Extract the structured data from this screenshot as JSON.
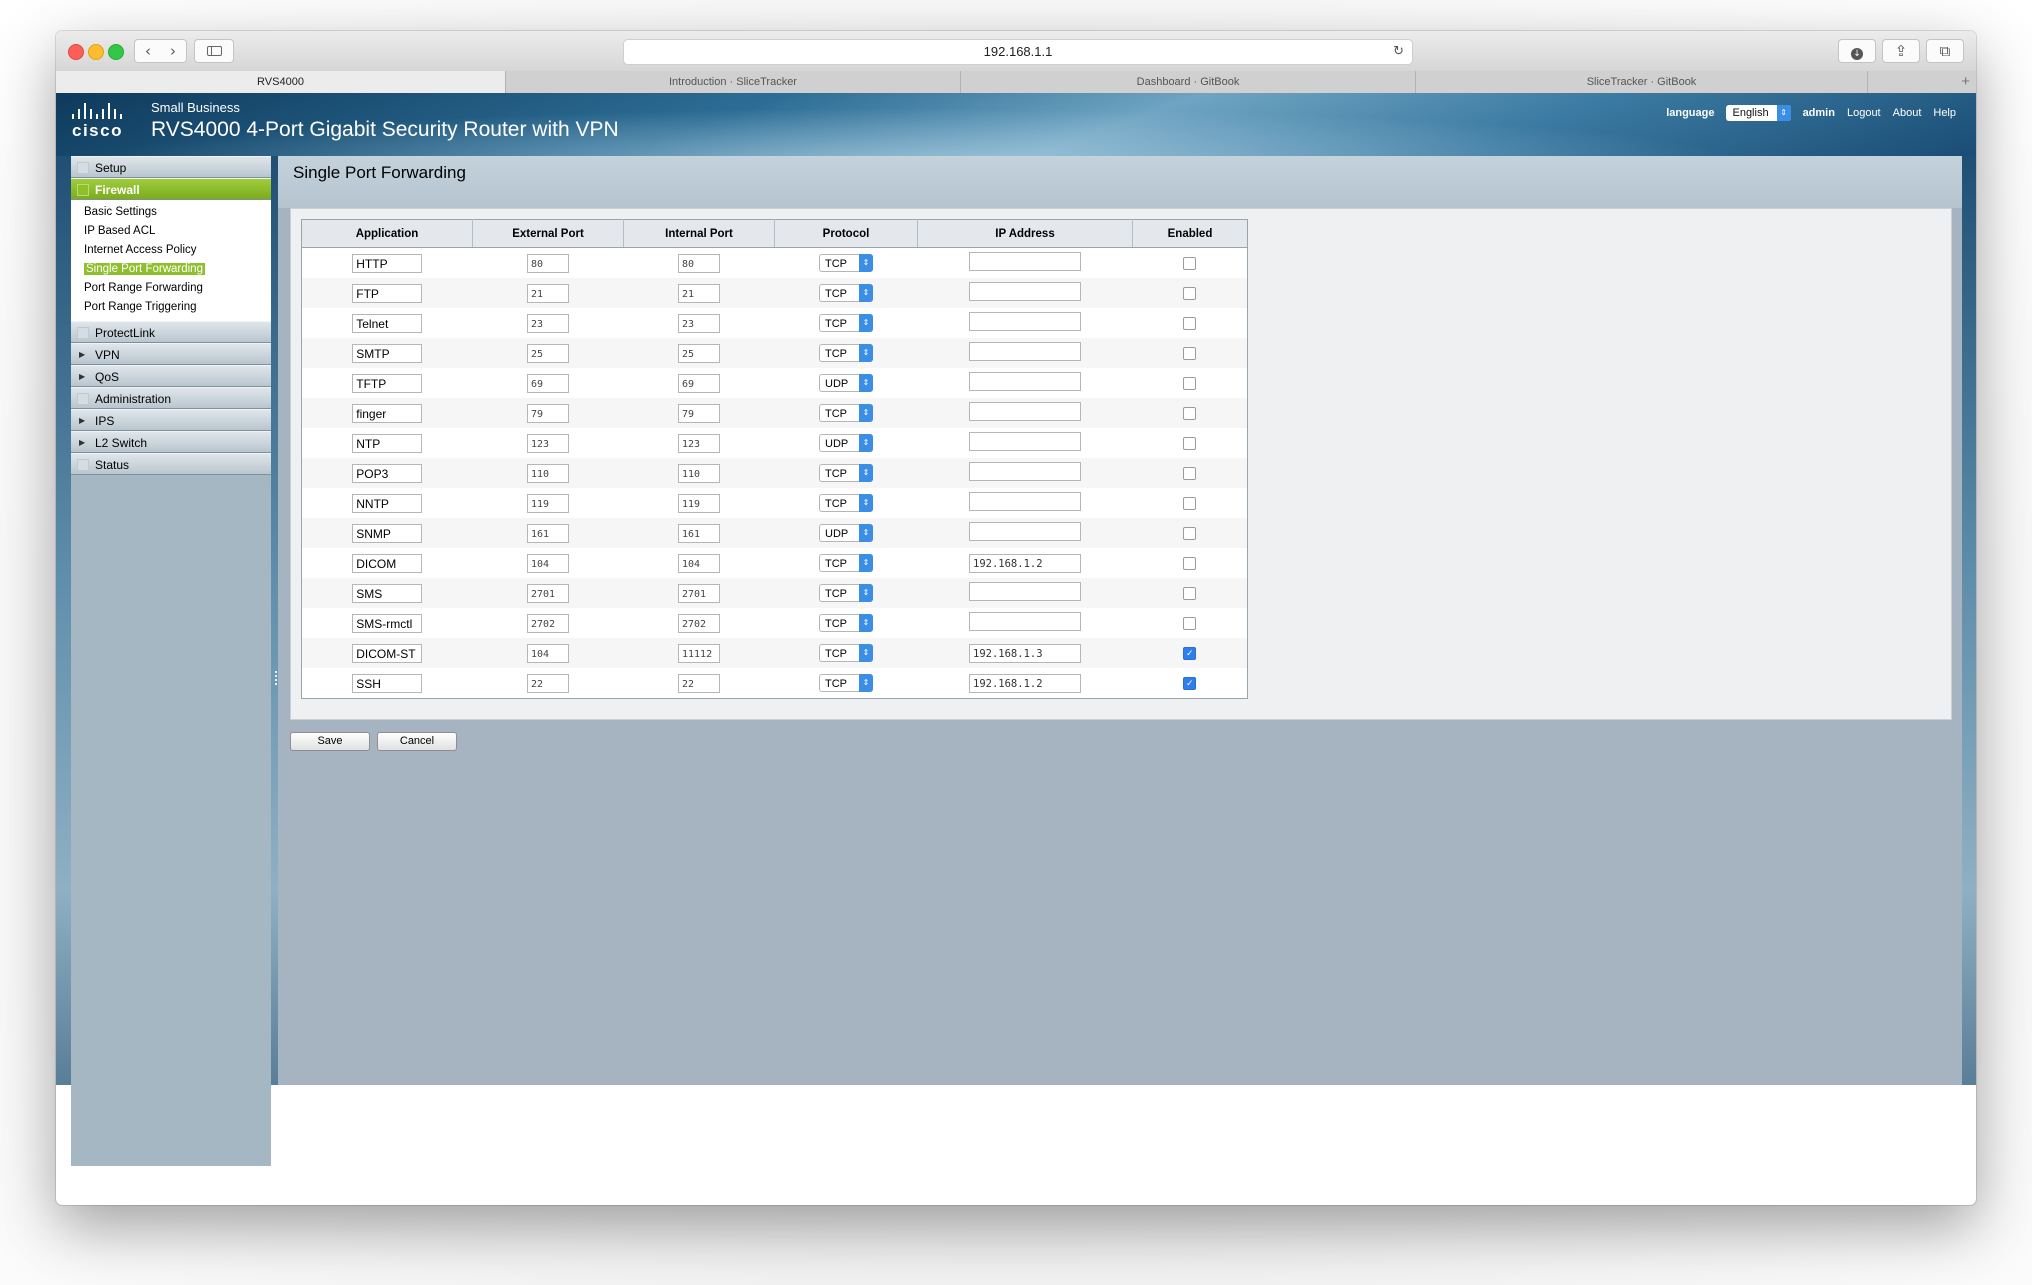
{
  "browser": {
    "address": "192.168.1.1",
    "tabs": [
      {
        "label": "RVS4000",
        "active": true
      },
      {
        "label": "Introduction · SliceTracker",
        "active": false
      },
      {
        "label": "Dashboard · GitBook",
        "active": false
      },
      {
        "label": "SliceTracker · GitBook",
        "active": false
      }
    ],
    "new_tab": "+"
  },
  "header": {
    "brand": "cisco",
    "small_business": "Small Business",
    "title": "RVS4000 4-Port Gigabit Security Router with VPN",
    "language_label": "language",
    "language_value": "English",
    "user": "admin",
    "logout": "Logout",
    "about": "About",
    "help": "Help"
  },
  "sidenav": {
    "items": [
      {
        "label": "Setup"
      },
      {
        "label": "Firewall",
        "active": true
      },
      {
        "label": "ProtectLink"
      },
      {
        "label": "VPN",
        "expandable": true
      },
      {
        "label": "QoS",
        "expandable": true
      },
      {
        "label": "Administration"
      },
      {
        "label": "IPS",
        "expandable": true
      },
      {
        "label": "L2 Switch",
        "expandable": true
      },
      {
        "label": "Status"
      }
    ],
    "firewall_sub": [
      {
        "label": "Basic Settings"
      },
      {
        "label": "IP Based ACL"
      },
      {
        "label": "Internet Access Policy"
      },
      {
        "label": "Single Port Forwarding",
        "active": true
      },
      {
        "label": "Port Range Forwarding"
      },
      {
        "label": "Port Range Triggering"
      }
    ]
  },
  "main": {
    "page_title": "Single Port Forwarding",
    "columns": [
      "Application",
      "External Port",
      "Internal Port",
      "Protocol",
      "IP Address",
      "Enabled"
    ],
    "rows": [
      {
        "app": "HTTP",
        "ext": "80",
        "int": "80",
        "proto": "TCP",
        "ip": "",
        "enabled": false
      },
      {
        "app": "FTP",
        "ext": "21",
        "int": "21",
        "proto": "TCP",
        "ip": "",
        "enabled": false
      },
      {
        "app": "Telnet",
        "ext": "23",
        "int": "23",
        "proto": "TCP",
        "ip": "",
        "enabled": false
      },
      {
        "app": "SMTP",
        "ext": "25",
        "int": "25",
        "proto": "TCP",
        "ip": "",
        "enabled": false
      },
      {
        "app": "TFTP",
        "ext": "69",
        "int": "69",
        "proto": "UDP",
        "ip": "",
        "enabled": false
      },
      {
        "app": "finger",
        "ext": "79",
        "int": "79",
        "proto": "TCP",
        "ip": "",
        "enabled": false
      },
      {
        "app": "NTP",
        "ext": "123",
        "int": "123",
        "proto": "UDP",
        "ip": "",
        "enabled": false
      },
      {
        "app": "POP3",
        "ext": "110",
        "int": "110",
        "proto": "TCP",
        "ip": "",
        "enabled": false
      },
      {
        "app": "NNTP",
        "ext": "119",
        "int": "119",
        "proto": "TCP",
        "ip": "",
        "enabled": false
      },
      {
        "app": "SNMP",
        "ext": "161",
        "int": "161",
        "proto": "UDP",
        "ip": "",
        "enabled": false
      },
      {
        "app": "DICOM",
        "ext": "104",
        "int": "104",
        "proto": "TCP",
        "ip": "192.168.1.2",
        "enabled": false
      },
      {
        "app": "SMS",
        "ext": "2701",
        "int": "2701",
        "proto": "TCP",
        "ip": "",
        "enabled": false
      },
      {
        "app": "SMS-rmctl",
        "ext": "2702",
        "int": "2702",
        "proto": "TCP",
        "ip": "",
        "enabled": false
      },
      {
        "app": "DICOM-ST",
        "ext": "104",
        "int": "11112",
        "proto": "TCP",
        "ip": "192.168.1.3",
        "enabled": true
      },
      {
        "app": "SSH",
        "ext": "22",
        "int": "22",
        "proto": "TCP",
        "ip": "192.168.1.2",
        "enabled": true
      }
    ],
    "save_label": "Save",
    "cancel_label": "Cancel"
  },
  "colors": {
    "accent_green": "#8fbf2d",
    "header_blue": "#2d6d95",
    "select_blue": "#3a8ee6",
    "check_blue": "#2d7ff0"
  }
}
